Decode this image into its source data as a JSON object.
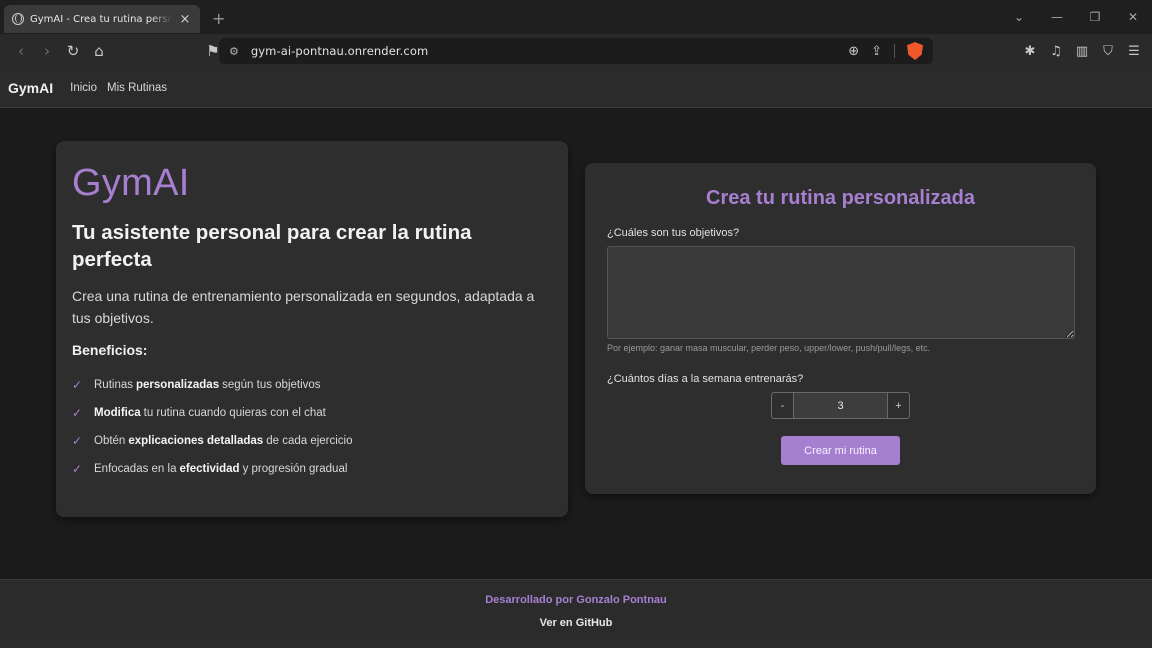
{
  "browser": {
    "tab_title": "GymAI - Crea tu rutina personalizada",
    "url": "gym-ai-pontnau.onrender.com"
  },
  "icons": {
    "tab_favicon": "globe-icon",
    "tab_close": "close-icon",
    "new_tab": "plus-icon",
    "back": "arrow-left-icon",
    "forward": "arrow-right-icon",
    "reload": "reload-icon",
    "home": "home-icon",
    "bookmark": "bookmark-icon",
    "site_settings": "tune-icon",
    "zoom": "zoom-icon",
    "share": "share-icon",
    "brave_shields": "brave-lion-icon",
    "extensions": "puzzle-icon",
    "media": "music-note-icon",
    "sidebar": "sidebar-icon",
    "vpn": "shield-icon",
    "menu": "hamburger-icon",
    "tab_list": "chevron-down-icon",
    "minimize": "minimize-icon",
    "restore": "restore-icon",
    "close_window": "close-icon",
    "benefit_check": "check-icon"
  },
  "colors": {
    "accent": "#a77fd1",
    "page_bg": "#1c1c1c",
    "card_bg": "#2e2e2e"
  },
  "nav": {
    "brand": "GymAI",
    "links": [
      "Inicio",
      "Mis Rutinas"
    ]
  },
  "hero": {
    "title": "GymAI",
    "subtitle": "Tu asistente personal para crear la rutina perfecta",
    "description": "Crea una rutina de entrenamiento personalizada en segundos, adaptada a tus objetivos.",
    "benefits_title": "Beneficios:",
    "benefits": [
      {
        "pre": "Rutinas",
        "bold": "personalizadas",
        "post": "según tus objetivos"
      },
      {
        "pre": "",
        "bold": "Modifica",
        "post": "tu rutina cuando quieras con el chat"
      },
      {
        "pre": "Obtén",
        "bold": "explicaciones detalladas",
        "post": "de cada ejercicio"
      },
      {
        "pre": "Enfocadas en la",
        "bold": "efectividad",
        "post": "y progresión gradual"
      }
    ]
  },
  "form": {
    "title": "Crea tu rutina personalizada",
    "objectives_label": "¿Cuáles son tus objetivos?",
    "objectives_value": "",
    "objectives_hint": "Por ejemplo: ganar masa muscular, perder peso, upper/lower, push/pull/legs, etc.",
    "days_label": "¿Cuántos días a la semana entrenarás?",
    "days_value": "3",
    "minus_label": "-",
    "plus_label": "+",
    "submit_label": "Crear mi rutina"
  },
  "footer": {
    "credit": "Desarrollado por Gonzalo Pontnau",
    "github": "Ver en GitHub"
  }
}
